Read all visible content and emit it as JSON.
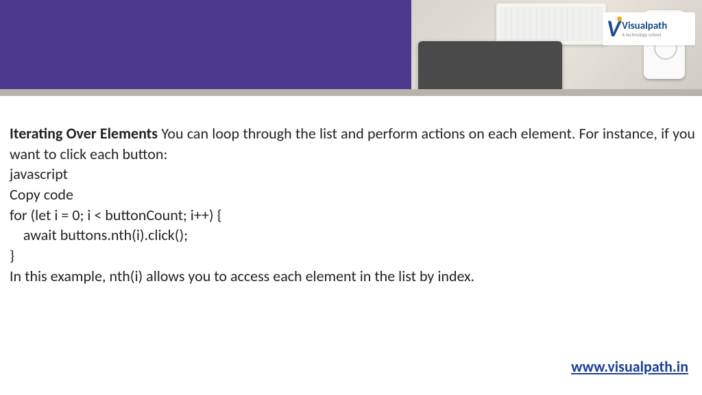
{
  "logo": {
    "letter": "V",
    "name": "Visualpath",
    "tagline": "A technology school"
  },
  "content": {
    "title": "Iterating Over Elements",
    "intro_after_title": " You can loop through the list and perform actions on each element. For instance, if you want to click each button:",
    "lang": "javascript",
    "copy": "Copy code",
    "code1": "for (let i = 0; i < buttonCount; i++) {",
    "code2": "    await buttons.nth(i).click();",
    "code3": "}",
    "outro": "In this example, nth(i) allows you to access each element in the list by index."
  },
  "footer": {
    "url": "www.visualpath.in"
  }
}
